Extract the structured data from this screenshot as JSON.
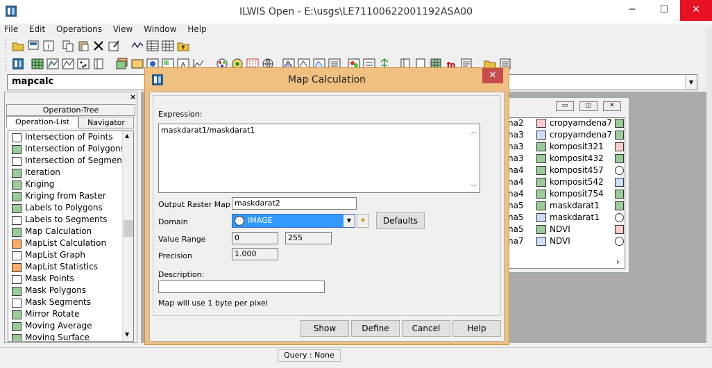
{
  "window": {
    "title": "ILWIS Open - E:\\usgs\\LE71100622001192ASA00",
    "minimize": "─",
    "maximize": "☐",
    "close": "✕"
  },
  "menu": [
    "File",
    "Edit",
    "Operations",
    "View",
    "Window",
    "Help"
  ],
  "command_line": {
    "value": "mapcalc"
  },
  "left_panel": {
    "close": "×",
    "tabs": [
      "Operation-Tree",
      "Operation-List",
      "Navigator"
    ],
    "operations": [
      "Intersection of Points",
      "Intersection of Polygons",
      "Intersection of Segments",
      "Iteration",
      "Kriging",
      "Kriging from Raster",
      "Labels to Polygons",
      "Labels to Segments",
      "Map Calculation",
      "MapList Calculation",
      "MapList Graph",
      "MapList Statistics",
      "Mask Points",
      "Mask Polygons",
      "Mask Segments",
      "Mirror Rotate",
      "Moving Average",
      "Moving Surface"
    ]
  },
  "catalog": {
    "col1": [
      "na2",
      "na3",
      "na3",
      "na3",
      "na4",
      "na4",
      "na4",
      "na5",
      "na5",
      "na5",
      "na7"
    ],
    "col2": [
      "cropyamdena7",
      "cropyamdena7",
      "komposit321",
      "komposit432",
      "komposit457",
      "komposit542",
      "komposit754",
      "maskdarat1",
      "maskdarat1",
      "NDVI",
      "NDVI"
    ]
  },
  "dialog": {
    "title": "Map Calculation",
    "close": "✕",
    "expression_label": "Expression:",
    "expression_value": "maskdarat1/maskdarat1",
    "output_label": "Output Raster Map",
    "output_value": "maskdarat2",
    "domain_label": "Domain",
    "domain_value": "IMAGE",
    "defaults_button": "Defaults",
    "value_range_label": "Value Range",
    "value_range_min": "0",
    "value_range_max": "255",
    "precision_label": "Precision",
    "precision_value": "1.000",
    "description_label": "Description:",
    "description_value": "",
    "info": "Map will use 1 byte per pixel",
    "buttons": {
      "show": "Show",
      "define": "Define",
      "cancel": "Cancel",
      "help": "Help"
    }
  },
  "status": {
    "query": "Query : None"
  }
}
